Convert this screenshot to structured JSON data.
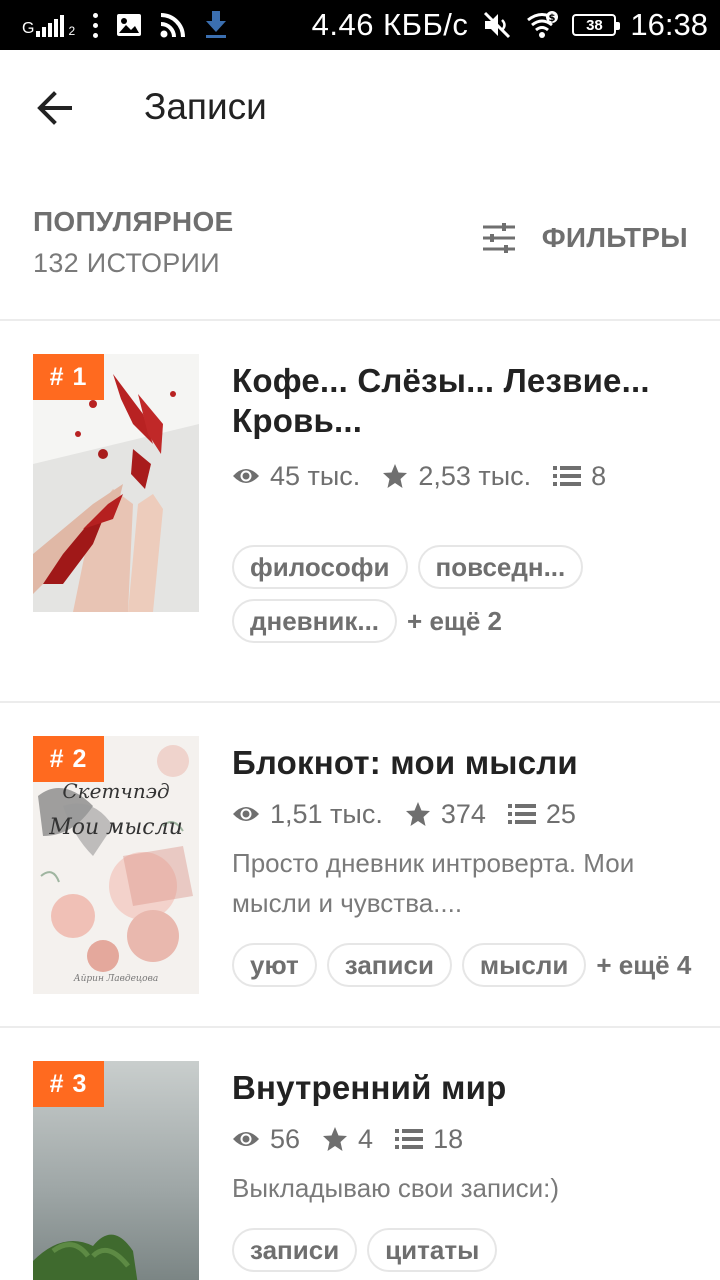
{
  "status_bar": {
    "network_label": "G",
    "sim_number": "2",
    "net_speed": "4.46 КББ/с",
    "battery": "38",
    "time": "16:38"
  },
  "app_bar": {
    "title": "Записи"
  },
  "section": {
    "title": "ПОПУЛЯРНОЕ",
    "count": "132 ИСТОРИИ",
    "filters_label": "ФИЛЬТРЫ"
  },
  "colors": {
    "accent": "#ff6a1f",
    "muted_text": "#6f6f6f",
    "divider": "#ececec"
  },
  "stories": [
    {
      "rank": "# 1",
      "title": "Кофе... Слёзы... Лезвие... Кровь...",
      "views": "45 тыс.",
      "votes": "2,53 тыс.",
      "parts": "8",
      "description": "",
      "tags": [
        "философи",
        "повседн...",
        "дневник..."
      ],
      "more_tags": "+ ещё 2"
    },
    {
      "rank": "# 2",
      "title": "Блокнот: мои мысли",
      "views": "1,51 тыс.",
      "votes": "374",
      "parts": "25",
      "description": "Просто дневник интроверта. Мои мысли и чувства....",
      "cover_text_1": "Скетчпэд",
      "cover_text_2": "Мои мысли",
      "cover_signature": "Айрин Лавдецова",
      "tags": [
        "уют",
        "записи",
        "мысли"
      ],
      "more_tags": "+ ещё 4"
    },
    {
      "rank": "# 3",
      "title": "Внутренний мир",
      "views": "56",
      "votes": "4",
      "parts": "18",
      "description": "Выкладываю свои записи:)",
      "tags": [
        "записи",
        "цитаты"
      ],
      "more_tags": ""
    }
  ]
}
